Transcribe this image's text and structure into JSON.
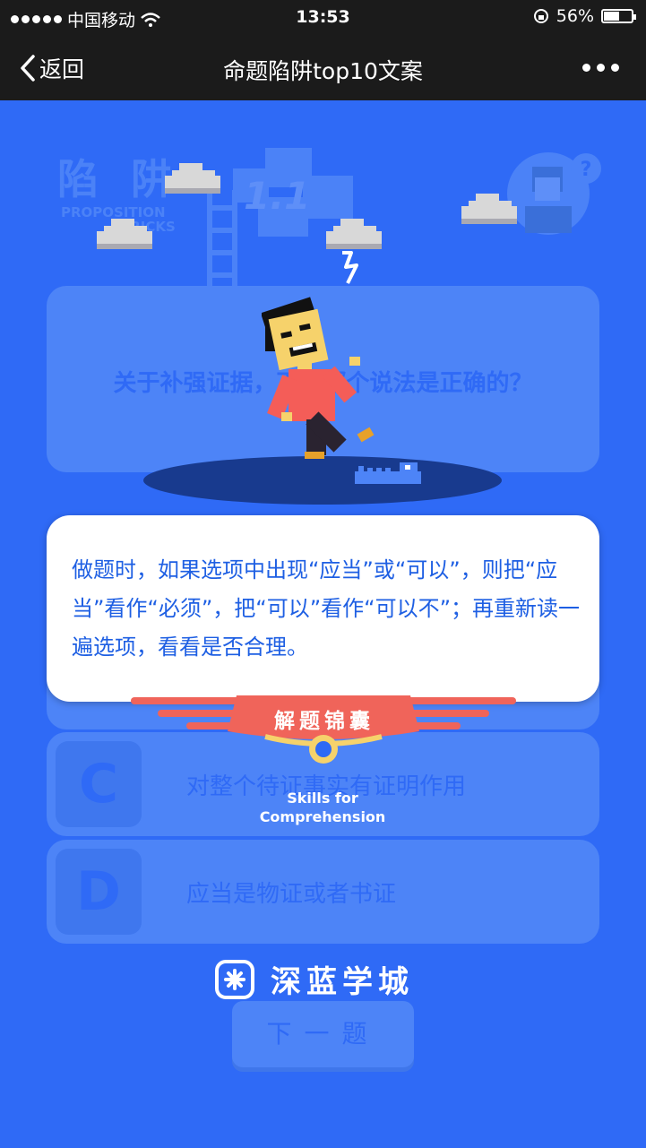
{
  "status": {
    "carrier": "中国移动",
    "time": "13:53",
    "battery": "56%",
    "battery_level": 0.56
  },
  "nav": {
    "back_label": "返回",
    "title": "命题陷阱top10文案"
  },
  "background": {
    "heading": "陷 阱",
    "subheading_1": "PROPOSITION",
    "subheading_2": "TRICKS",
    "version": "1.1"
  },
  "question": {
    "text": "关于补强证据，下列哪个说法是正确的？"
  },
  "options": [
    {
      "letter": "C",
      "text": "对整个待证事实有证明作用"
    },
    {
      "letter": "D",
      "text": "应当是物证或者书证"
    }
  ],
  "tip": {
    "text": "做题时，如果选项中出现“应当”或“可以”，则把“应当”看作“必须”，把“可以”看作“可以不”；再重新读一遍选项，看看是否合理。",
    "ribbon_label": "解题锦囊",
    "skills_line1": "Skills for",
    "skills_line2": "Comprehension"
  },
  "brand": {
    "name": "深蓝学城"
  },
  "next_button": {
    "label": "下一题"
  },
  "colors": {
    "background": "#2f6af6",
    "card": "#4d84f7",
    "ribbon": "#f0645a",
    "tip_text": "#1e5fe3"
  }
}
